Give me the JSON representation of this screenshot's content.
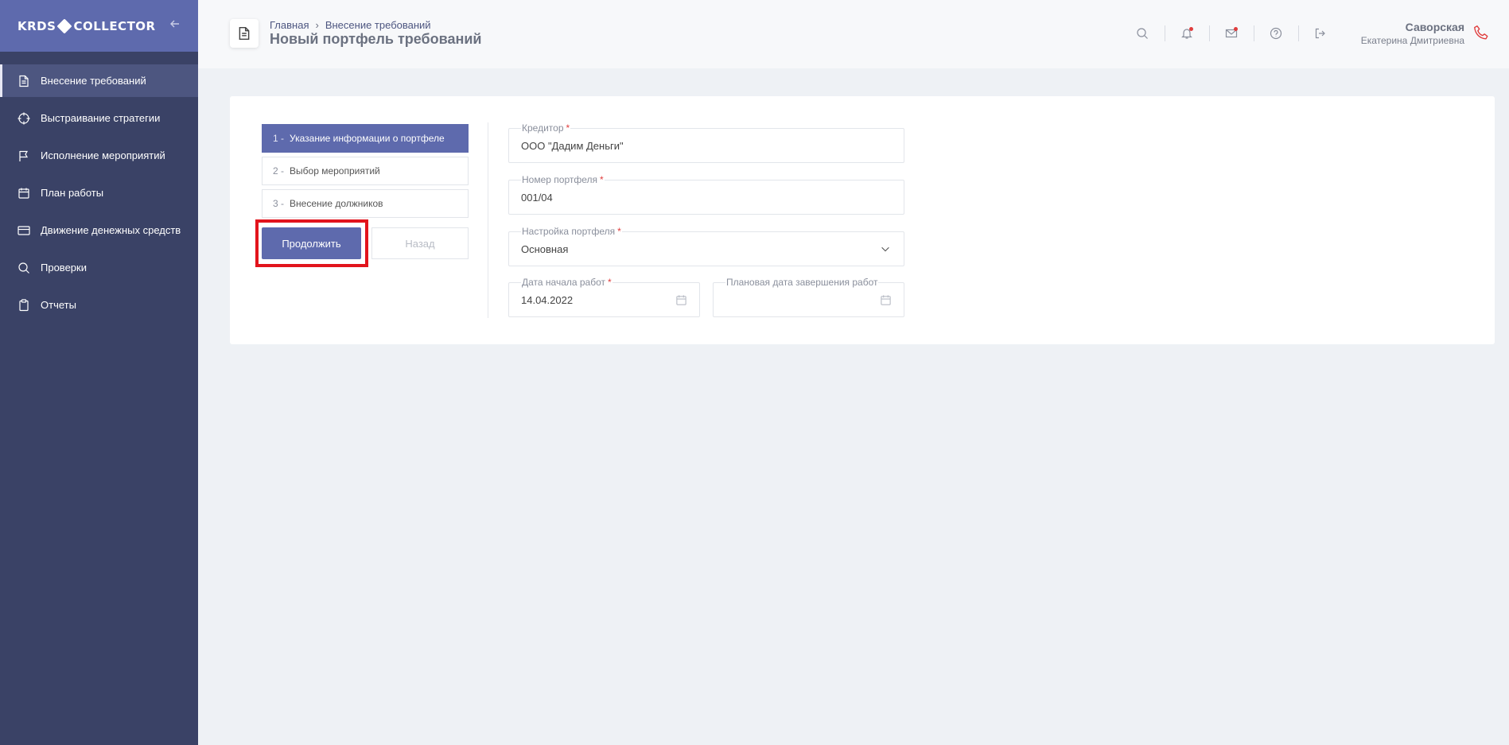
{
  "sidebar": {
    "logo_left": "KRDS",
    "logo_right": "COLLECTOR",
    "items": [
      {
        "label": "Внесение требований",
        "icon": "document-icon"
      },
      {
        "label": "Выстраивание стратегии",
        "icon": "target-icon"
      },
      {
        "label": "Исполнение мероприятий",
        "icon": "flag-icon"
      },
      {
        "label": "План работы",
        "icon": "calendar-icon"
      },
      {
        "label": "Движение денежных средств",
        "icon": "credit-card-icon"
      },
      {
        "label": "Проверки",
        "icon": "search-icon"
      },
      {
        "label": "Отчеты",
        "icon": "clipboard-icon"
      }
    ]
  },
  "header": {
    "breadcrumb_home": "Главная",
    "breadcrumb_sep": "›",
    "breadcrumb_current": "Внесение требований",
    "title": "Новый портфель требований",
    "user_last_name": "Саворская",
    "user_first_names": "Екатерина Дмитриевна"
  },
  "steps": [
    {
      "num": "1 -",
      "label": "Указание информации о портфеле"
    },
    {
      "num": "2 -",
      "label": "Выбор мероприятий"
    },
    {
      "num": "3 -",
      "label": "Внесение должников"
    }
  ],
  "buttons": {
    "continue": "Продолжить",
    "back": "Назад"
  },
  "form": {
    "creditor_label": "Кредитор",
    "creditor_value": "ООО \"Дадим Деньги\"",
    "portfolio_number_label": "Номер портфеля",
    "portfolio_number_value": "001/04",
    "portfolio_setting_label": "Настройка портфеля",
    "portfolio_setting_value": "Основная",
    "start_date_label": "Дата начала работ",
    "start_date_value": "14.04.2022",
    "end_date_label": "Плановая дата завершения работ",
    "end_date_value": "",
    "required_mark": "*"
  },
  "colors": {
    "accent": "#5e6aad",
    "sidebar": "#3a4266",
    "highlight": "#e2141c",
    "notification_dot": "#e03c3c"
  }
}
